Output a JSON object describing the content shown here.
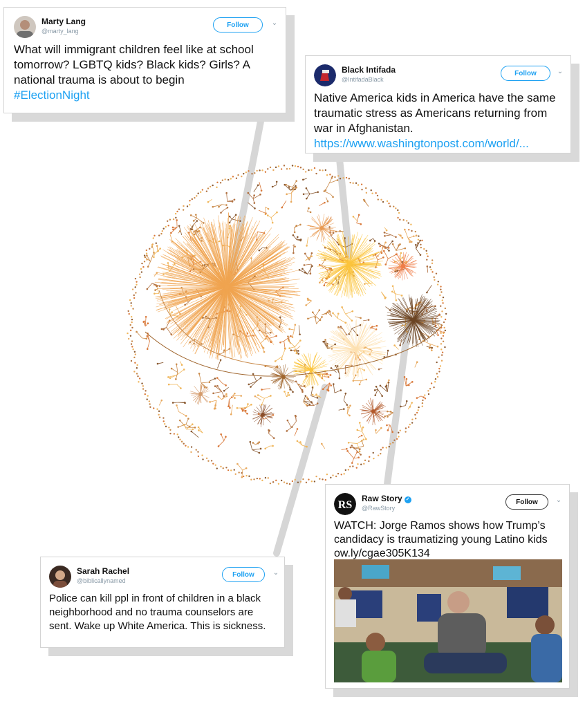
{
  "tweets": [
    {
      "name": "Marty Lang",
      "handle": "@marty_lang",
      "follow": "Follow",
      "text": "What will immigrant children feel like at school tomorrow? LGBTQ kids? Black kids? Girls? A national trauma is about to begin",
      "link": "#ElectionNight",
      "avatar_icon": "person-photo"
    },
    {
      "name": "Black Intifada",
      "handle": "@IntifadaBlack",
      "follow": "Follow",
      "text": "Native America kids in America have the same traumatic stress as Americans returning from war in Afghanistan.",
      "link": "https://www.washingtonpost.com/world/...",
      "avatar_icon": "fist-logo"
    },
    {
      "name": "Raw Story",
      "handle": "@RawStory",
      "follow": "Follow",
      "verified": true,
      "text": "WATCH: Jorge Ramos shows how Trump’s candidacy is traumatizing young Latino kids",
      "link": "ow.ly/cgae305K134",
      "avatar_icon": "rs-logo",
      "media": "classroom-photo"
    },
    {
      "name": "Sarah Rachel",
      "handle": "@biblicallynamed",
      "follow": "Follow",
      "text": "Police can kill ppl in front of children in a black neighborhood and no trauma counselors are sent. Wake up White America. This is sickness.",
      "link": "",
      "avatar_icon": "person-photo"
    }
  ],
  "colors": {
    "link": "#1da1f2",
    "cluster_main": "#f0a450",
    "cluster_yellow": "#fbc43c",
    "cluster_brown": "#6b4423",
    "cluster_orange": "#ef7b45",
    "connector": "#d6d6d6"
  }
}
